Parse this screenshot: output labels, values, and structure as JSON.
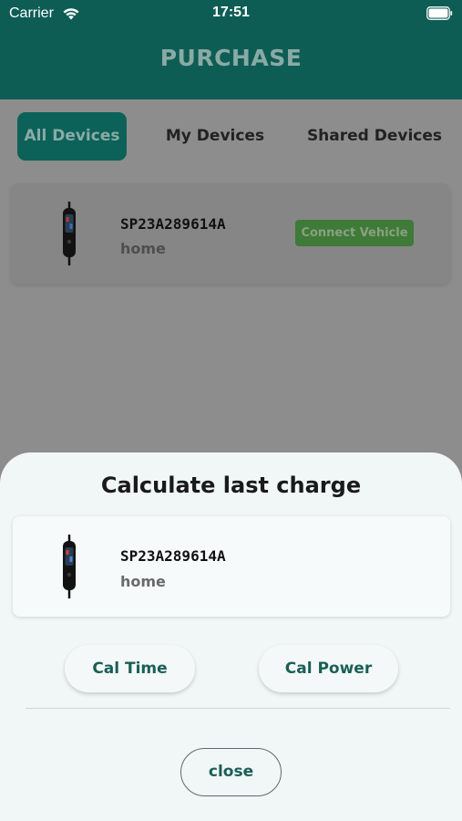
{
  "status_bar": {
    "carrier": "Carrier",
    "time": "17:51"
  },
  "header": {
    "title": "PURCHASE"
  },
  "tabs": [
    {
      "label": "All Devices",
      "selected": true
    },
    {
      "label": "My Devices",
      "selected": false
    },
    {
      "label": "Shared Devices",
      "selected": false
    }
  ],
  "device_list": [
    {
      "id": "SP23A289614A",
      "location": "home",
      "action_label": "Connect Vehicle"
    }
  ],
  "sheet": {
    "title": "Calculate last charge",
    "device": {
      "id": "SP23A289614A",
      "location": "home"
    },
    "cal_time_label": "Cal Time",
    "cal_power_label": "Cal Power",
    "close_label": "close"
  },
  "colors": {
    "header": "#0e5d55",
    "accent_text": "#1a5f58",
    "connect_button": "#3e7a38",
    "sheet_background": "#f1f6f6"
  },
  "icons": {
    "wifi": "wifi-icon",
    "battery": "battery-icon",
    "device": "charger-device-icon"
  }
}
